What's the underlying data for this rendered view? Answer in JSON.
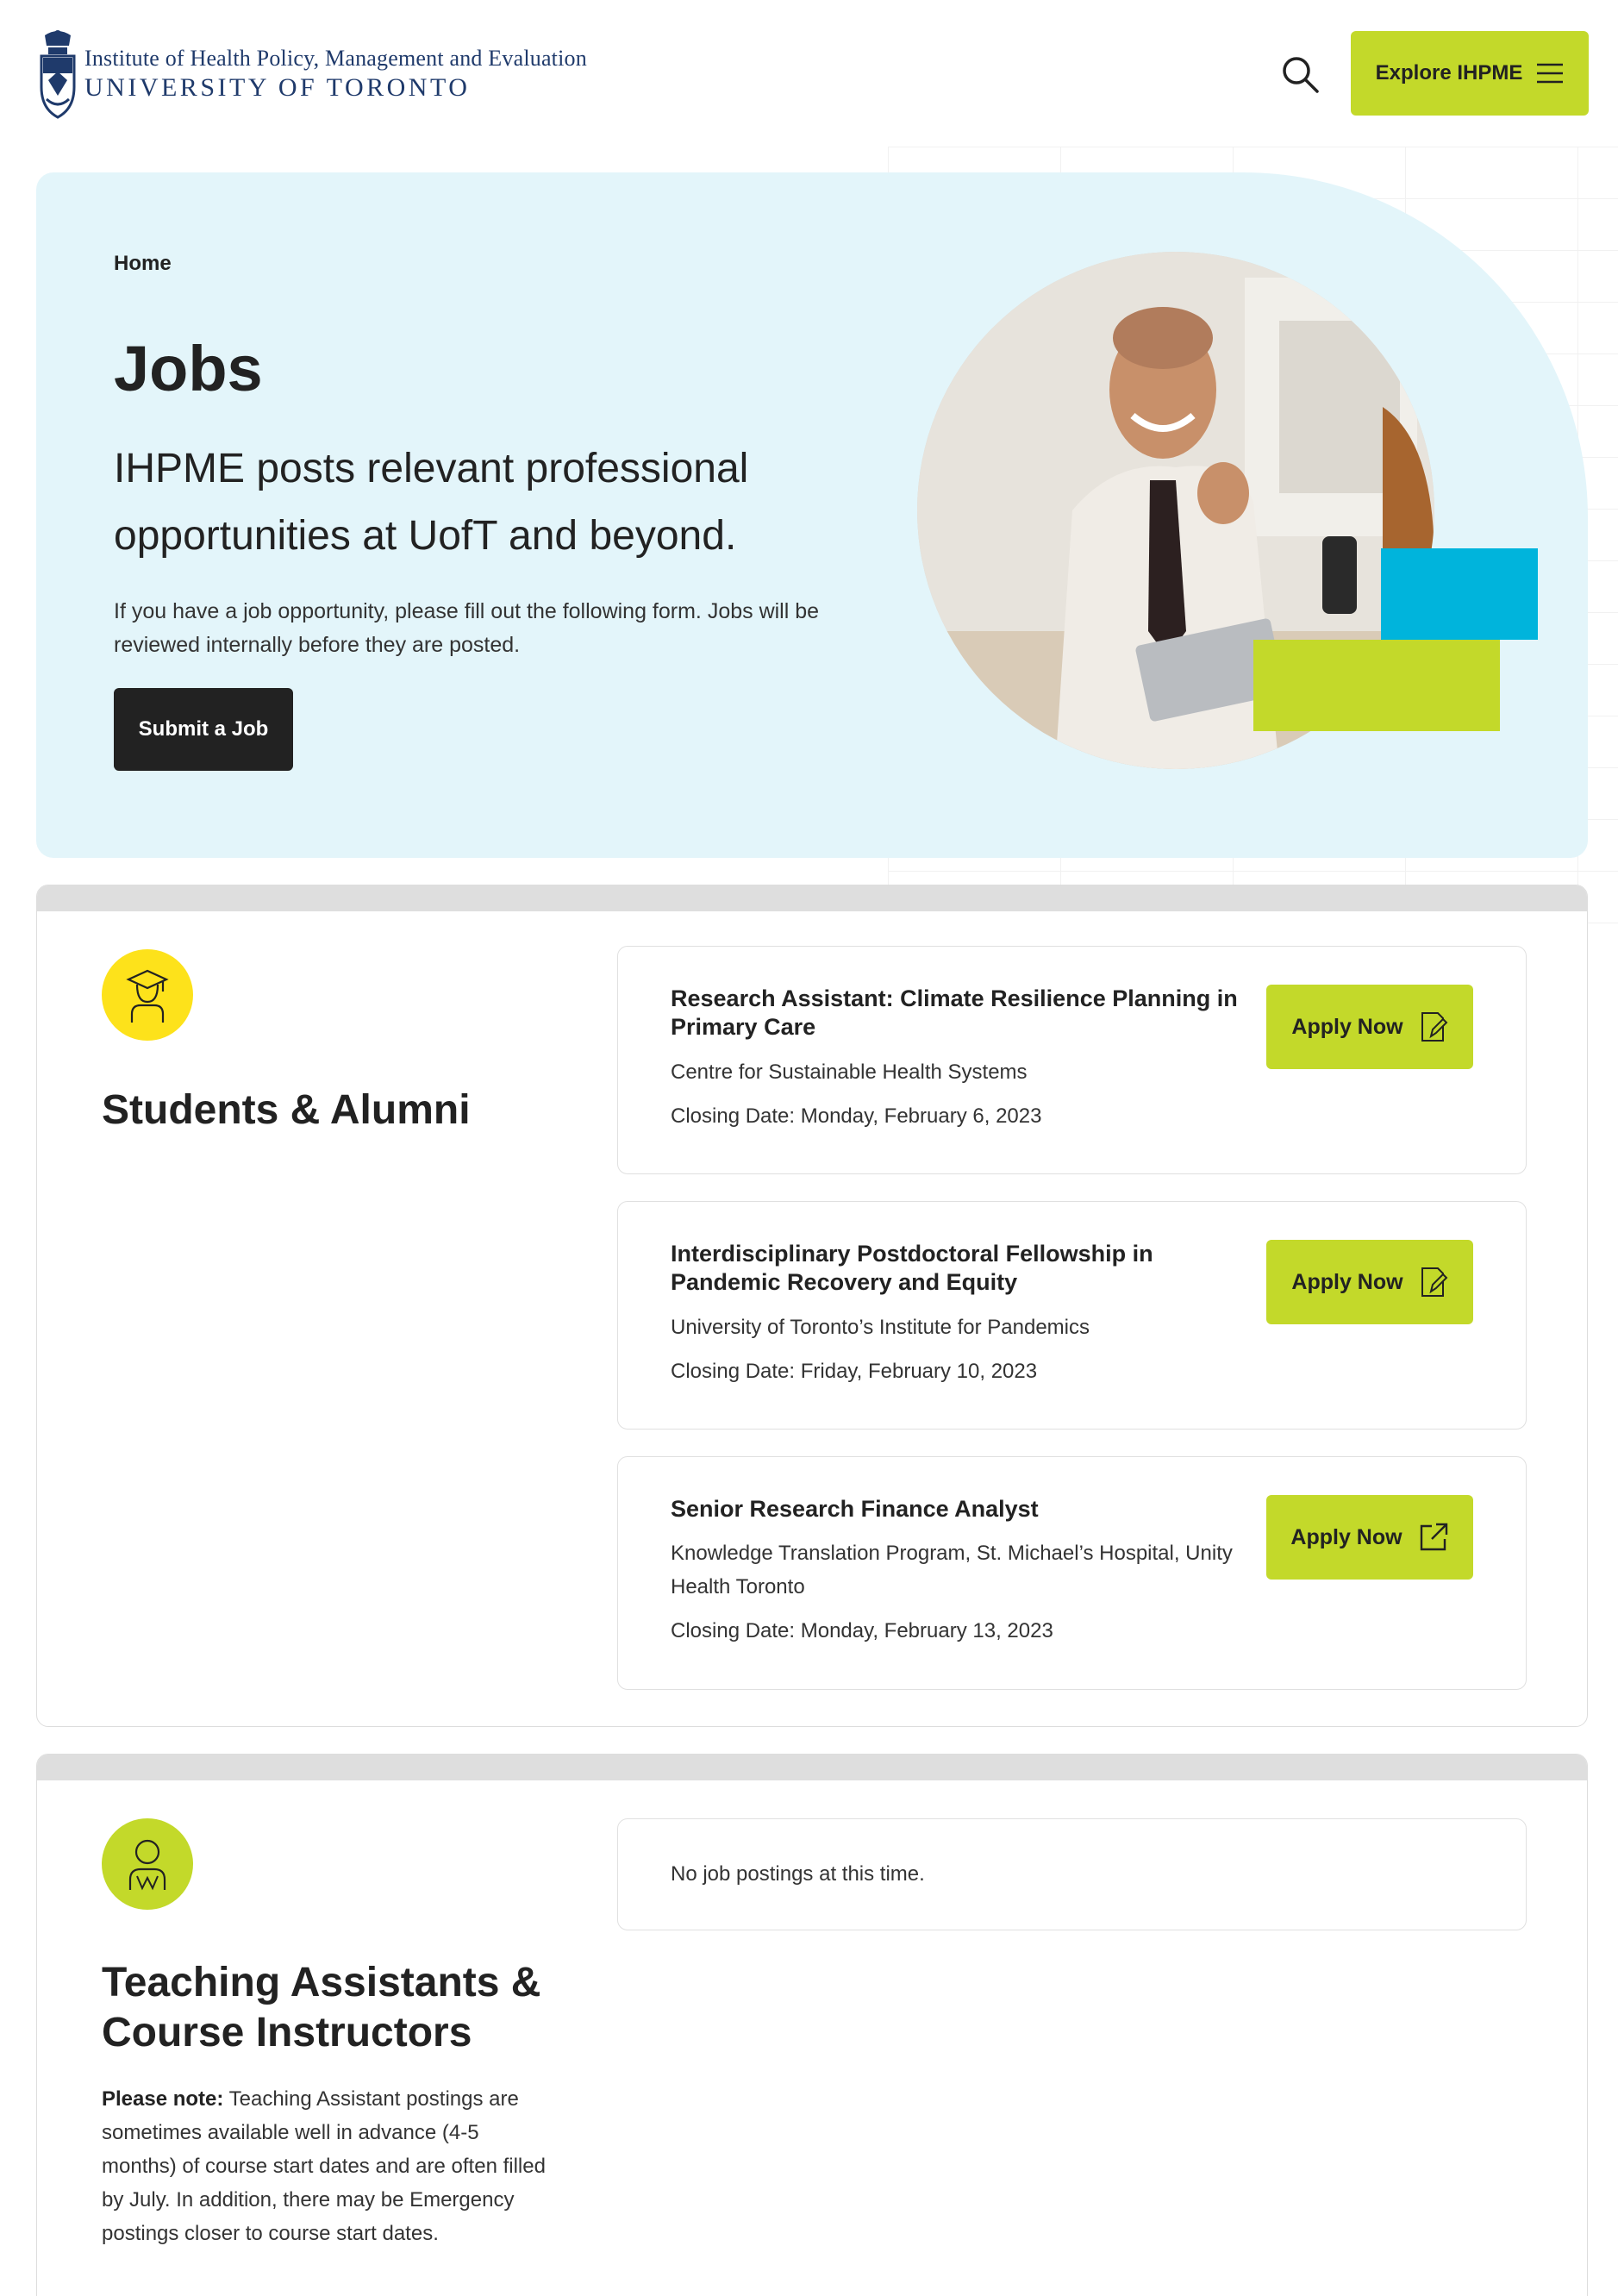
{
  "header": {
    "institute": "Institute of Health Policy, Management and Evaluation",
    "university": "UNIVERSITY OF TORONTO",
    "explore_label": "Explore IHPME"
  },
  "hero": {
    "breadcrumb": "Home",
    "title": "Jobs",
    "lead": "IHPME posts relevant professional opportunities at UofT and beyond.",
    "body": "If you have a job opportunity, please fill out the following form. Jobs will be reviewed internally before they are posted.",
    "submit_label": "Submit a Job"
  },
  "students": {
    "title": "Students & Alumni",
    "icon_color": "#fde21b",
    "jobs": [
      {
        "title": "Research Assistant: Climate Resilience Planning in Primary Care",
        "org": "Centre for Sustainable Health Systems",
        "closing": "Closing Date: Monday, February 6, 2023",
        "apply_label": "Apply Now",
        "icon": "edit-document-icon"
      },
      {
        "title": "Interdisciplinary Postdoctoral Fellowship in Pandemic Recovery and Equity",
        "org": "University of Toronto’s Institute for Pandemics",
        "closing": "Closing Date: Friday, February 10, 2023",
        "apply_label": "Apply Now",
        "icon": "edit-document-icon"
      },
      {
        "title": "Senior Research Finance Analyst",
        "org": "Knowledge Translation Program, St. Michael’s Hospital, Unity Health Toronto",
        "closing": "Closing Date: Monday, February 13, 2023",
        "apply_label": "Apply Now",
        "icon": "external-link-icon"
      }
    ]
  },
  "teaching": {
    "title": "Teaching Assistants & Course Instructors",
    "icon_color": "#c3d92a",
    "note_label": "Please note:",
    "note_text": " Teaching Assistant postings are sometimes available well in advance (4-5 months) of course start dates and are often filled by July. In addition, there may be Emergency postings closer to course start dates.",
    "empty": "No job postings at this time."
  },
  "colors": {
    "accent_lime": "#c3d92a",
    "accent_blue": "#00b4dc",
    "hero_bg": "#e3f5fa",
    "dark": "#222222"
  }
}
